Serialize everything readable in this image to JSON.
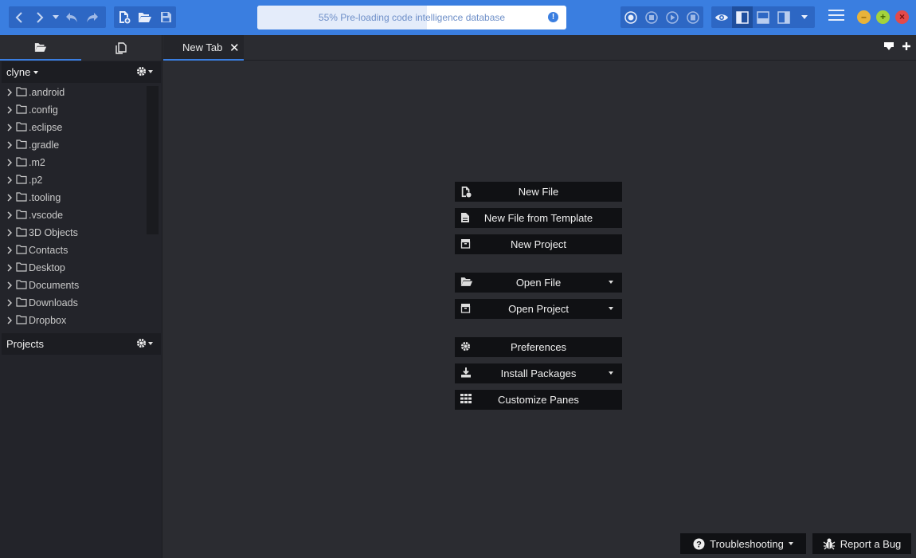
{
  "toolbar": {
    "progress_text": "55% Pre-loading code intelligence database",
    "progress_fraction": 0.55,
    "accent": "#3a7ee0"
  },
  "sidebar": {
    "places_root": "clyne",
    "folders": [
      ".android",
      ".config",
      ".eclipse",
      ".gradle",
      ".m2",
      ".p2",
      ".tooling",
      ".vscode",
      "3D Objects",
      "Contacts",
      "Desktop",
      "Documents",
      "Downloads",
      "Dropbox"
    ],
    "projects_label": "Projects"
  },
  "tabs": [
    {
      "label": "New Tab"
    }
  ],
  "start": {
    "new_file": "New File",
    "new_file_template": "New File from Template",
    "new_project": "New Project",
    "open_file": "Open File",
    "open_project": "Open Project",
    "preferences": "Preferences",
    "install_packages": "Install Packages",
    "customize_panes": "Customize Panes"
  },
  "footer": {
    "troubleshooting": "Troubleshooting",
    "report_bug": "Report a Bug"
  },
  "icons": {
    "back": "arrow-left-icon",
    "forward": "arrow-right-icon",
    "undo": "undo-icon",
    "redo": "redo-icon",
    "new_file": "new-file-icon",
    "open": "folder-open-icon",
    "save": "save-icon",
    "record": "record-icon",
    "stop": "stop-icon",
    "play": "play-icon",
    "save_macro": "macro-icon",
    "eye": "eye-icon",
    "left_pane": "left-pane-icon",
    "bottom_pane": "bottom-pane-icon",
    "right_pane": "right-pane-icon",
    "menu": "hamburger-icon",
    "minimize": "minimize-icon",
    "maximize": "maximize-icon",
    "close": "close-icon"
  }
}
